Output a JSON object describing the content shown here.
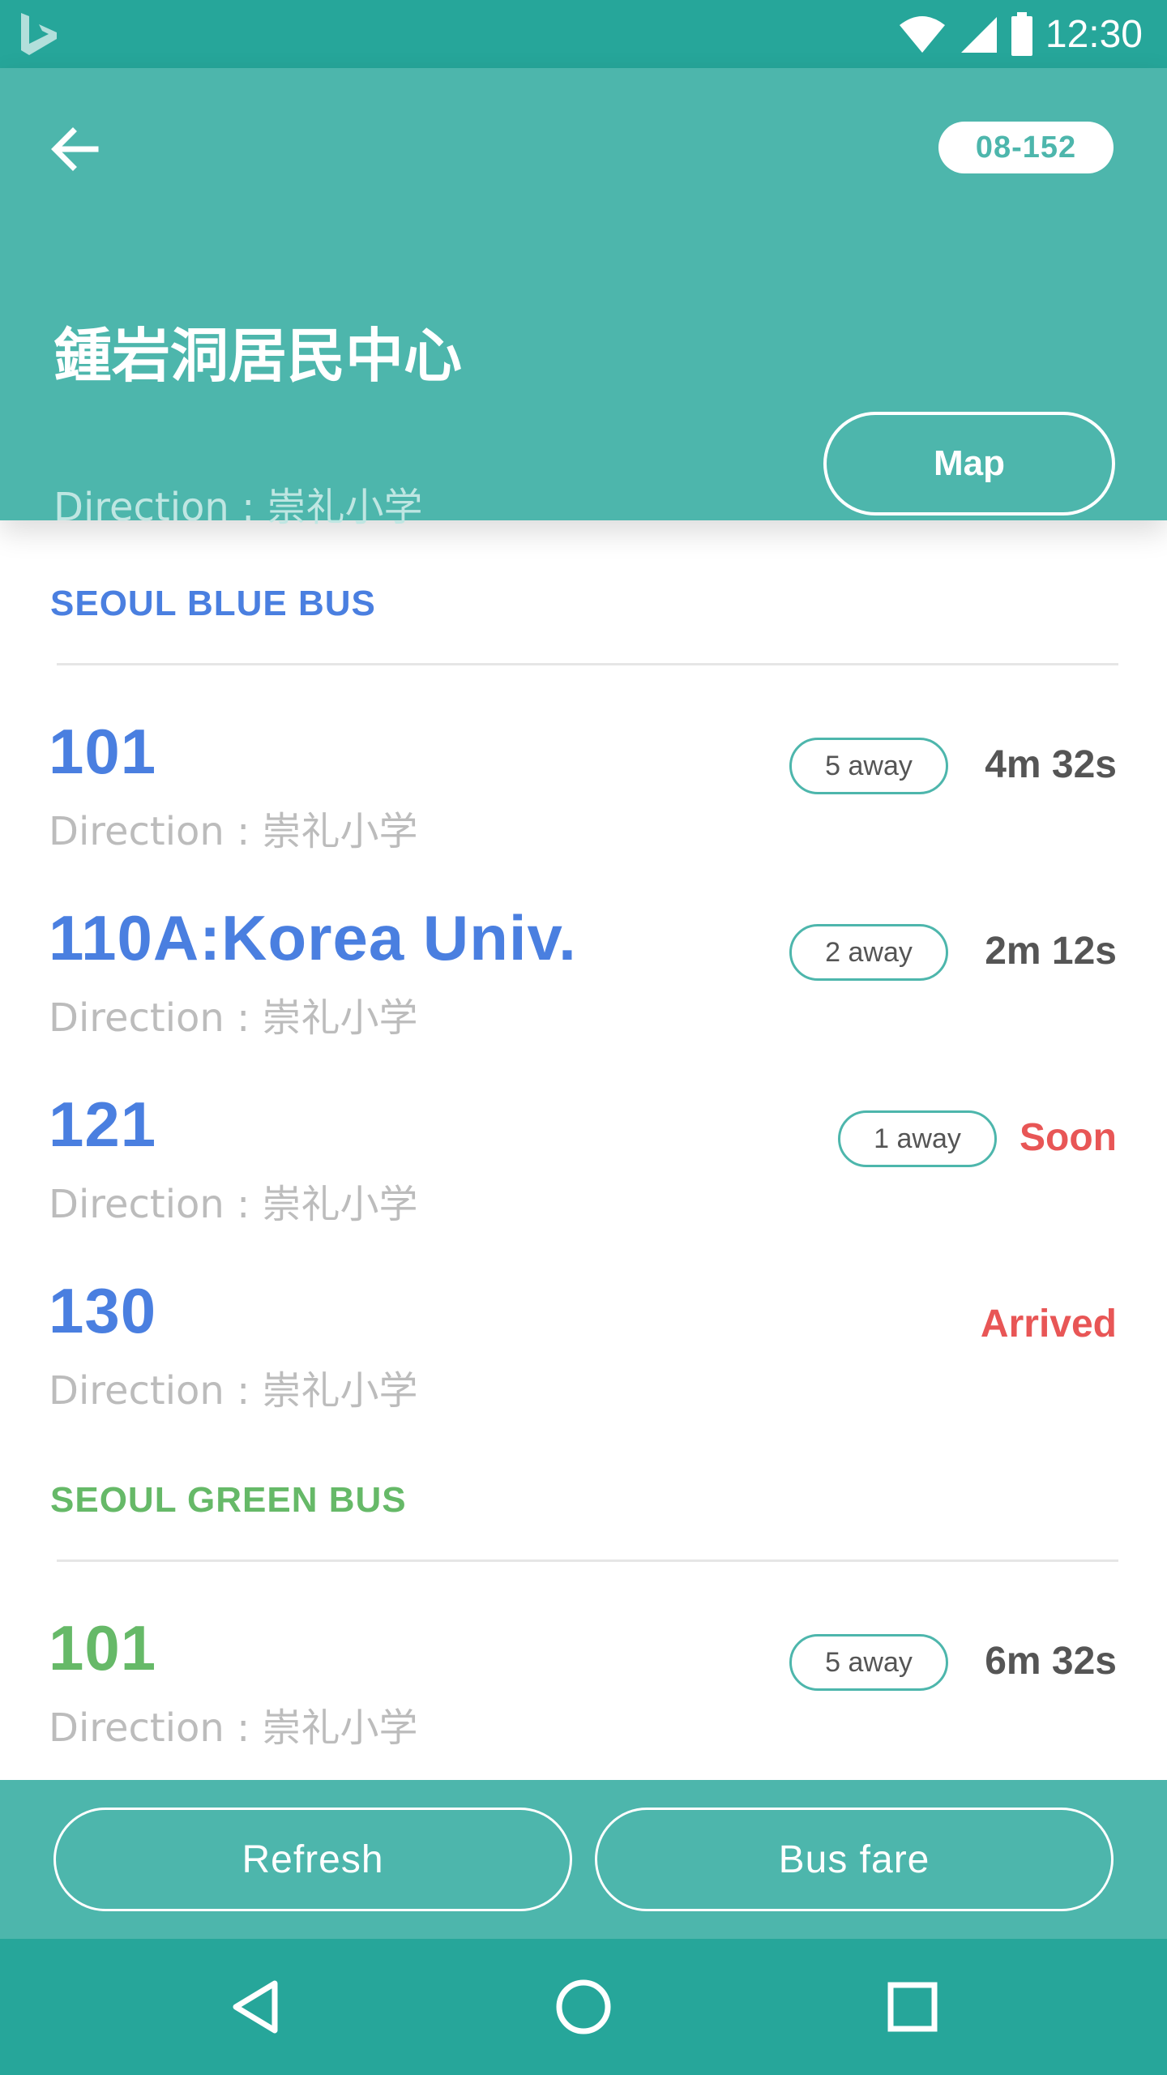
{
  "status_bar": {
    "time": "12:30",
    "icons": [
      "bing-logo-icon",
      "wifi-icon",
      "cellular-signal-icon",
      "battery-icon"
    ]
  },
  "header": {
    "back_icon": "arrow-left-icon",
    "stop_id": "08-152",
    "stop_name": "鍾岩洞居民中心",
    "direction": "Direction : 崇礼小学",
    "map_label": "Map"
  },
  "colors": {
    "primary": "#4db6ac",
    "primary_dark": "#26a69a",
    "blue": "#4a7fe0",
    "green": "#66b968",
    "red": "#e85656",
    "time_text": "#555555"
  },
  "sections": [
    {
      "title": "SEOUL BLUE BUS",
      "color": "#4a7fe0",
      "routes": [
        {
          "name": "101",
          "direction": "Direction : 崇礼小学",
          "away": "5 away",
          "arrival": "4m 32s",
          "arrival_color": "#555555"
        },
        {
          "name": "110A:Korea Univ.",
          "direction": "Direction : 崇礼小学",
          "away": "2 away",
          "arrival": "2m 12s",
          "arrival_color": "#555555"
        },
        {
          "name": "121",
          "direction": "Direction : 崇礼小学",
          "away": "1 away",
          "arrival": "Soon",
          "arrival_color": "#e85656"
        },
        {
          "name": "130",
          "direction": "Direction : 崇礼小学",
          "away": "",
          "arrival": "Arrived",
          "arrival_color": "#e85656"
        }
      ]
    },
    {
      "title": "SEOUL GREEN BUS",
      "color": "#66b968",
      "routes": [
        {
          "name": "101",
          "direction": "Direction : 崇礼小学",
          "away": "5 away",
          "arrival": "6m 32s",
          "arrival_color": "#555555"
        }
      ]
    }
  ],
  "actions": {
    "refresh_label": "Refresh",
    "bus_fare_label": "Bus fare"
  },
  "nav": {
    "icons": [
      "back-triangle-icon",
      "home-circle-icon",
      "recents-square-icon"
    ]
  }
}
